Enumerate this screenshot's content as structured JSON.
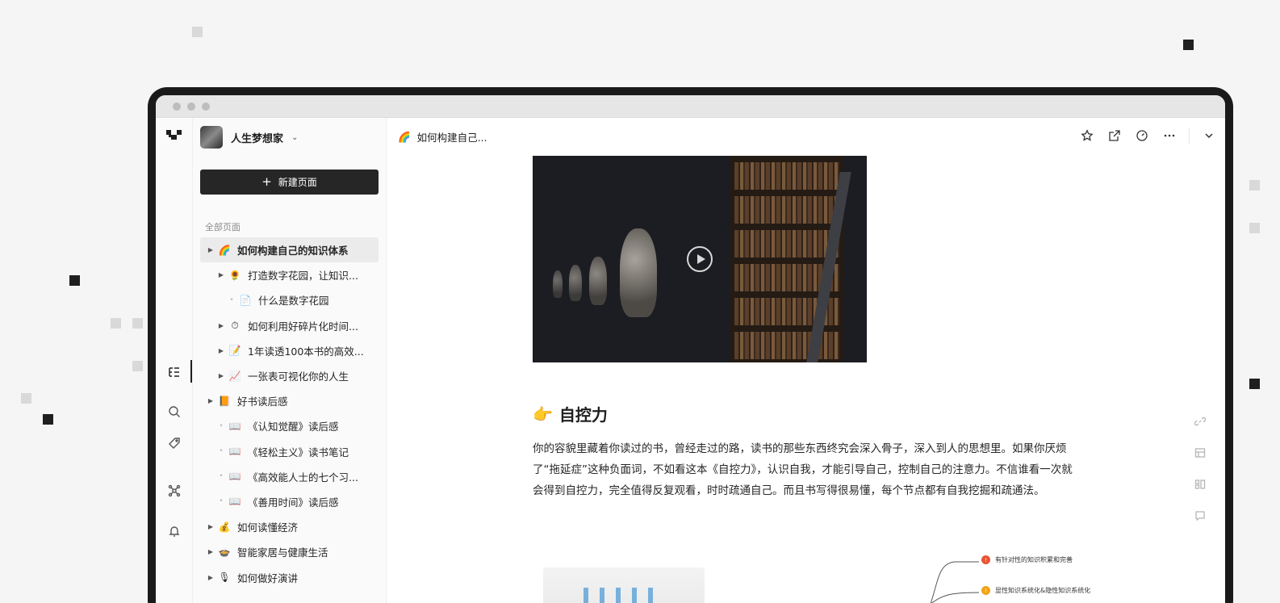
{
  "workspace": {
    "name": "人生梦想家"
  },
  "sidebar": {
    "new_page_label": "新建页面",
    "section_label": "全部页面",
    "items": [
      {
        "label": "如何构建自己的知识体系",
        "emoji": "🌈",
        "level": 0,
        "expandable": true,
        "active": true
      },
      {
        "label": "打造数字花园，让知识...",
        "emoji": "🌻",
        "level": 1,
        "expandable": true,
        "active": false
      },
      {
        "label": "什么是数字花园",
        "emoji": "📄",
        "level": 2,
        "expandable": false,
        "active": false
      },
      {
        "label": "如何利用好碎片化时间...",
        "emoji": "⏱",
        "level": 1,
        "expandable": true,
        "active": false
      },
      {
        "label": "1年读透100本书的高效...",
        "emoji": "📝",
        "level": 1,
        "expandable": true,
        "active": false
      },
      {
        "label": "一张表可视化你的人生",
        "emoji": "📈",
        "level": 1,
        "expandable": true,
        "active": false
      },
      {
        "label": "好书读后感",
        "emoji": "📙",
        "level": 0,
        "expandable": true,
        "active": false
      },
      {
        "label": "《认知觉醒》读后感",
        "emoji": "📖",
        "level": 1,
        "expandable": false,
        "active": false
      },
      {
        "label": "《轻松主义》读书笔记",
        "emoji": "📖",
        "level": 1,
        "expandable": false,
        "active": false
      },
      {
        "label": "《高效能人士的七个习...",
        "emoji": "📖",
        "level": 1,
        "expandable": false,
        "active": false
      },
      {
        "label": "《善用时间》读后感",
        "emoji": "📖",
        "level": 1,
        "expandable": false,
        "active": false
      },
      {
        "label": "如何读懂经济",
        "emoji": "💰",
        "level": 0,
        "expandable": true,
        "active": false
      },
      {
        "label": "智能家居与健康生活",
        "emoji": "🍲",
        "level": 0,
        "expandable": true,
        "active": false
      },
      {
        "label": "如何做好演讲",
        "emoji": "🎙",
        "level": 0,
        "expandable": true,
        "active": false
      }
    ]
  },
  "header": {
    "breadcrumb_emoji": "🌈",
    "breadcrumb_title": "如何构建自己...",
    "actions": [
      "star-icon",
      "share-icon",
      "history-icon",
      "more-icon",
      "collapse-icon"
    ]
  },
  "content": {
    "heading_emoji": "👉",
    "heading": "自控力",
    "paragraph": "你的容貌里藏着你读过的书，曾经走过的路，读书的那些东西终究会深入骨子，深入到人的思想里。如果你厌烦了“拖延症”这种负面词，不如看这本《自控力》，认识自我，才能引导自己，控制自己的注意力。不信谁看一次就会得到自控力，完全值得反复观看，时时疏通自己。而且书写得很易懂，每个节点都有自我挖掘和疏通法。",
    "mindmap_nodes": [
      {
        "label": "有针对性的知识积累和完善",
        "color": "#e8542f"
      },
      {
        "label": "显性知识系统化&隐性知识系统化",
        "color": "#f2a316"
      }
    ]
  },
  "colors": {
    "accent": "#262626",
    "sidebar_bg": "#fafafa",
    "page_bg": "#f5f5f5"
  }
}
